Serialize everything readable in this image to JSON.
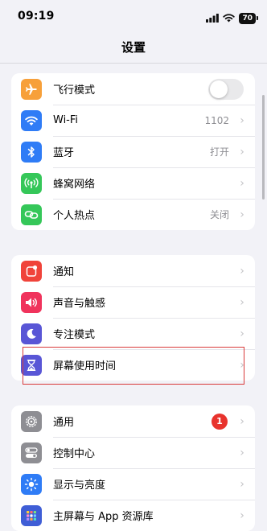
{
  "status": {
    "time": "09:19",
    "battery": "70"
  },
  "nav": {
    "title": "设置"
  },
  "colors": {
    "airplane": "#f7a03a",
    "wifi": "#2f7cf6",
    "bluetooth": "#2f7cf6",
    "cellular": "#35c759",
    "hotspot": "#35c759",
    "notifications": "#f0433a",
    "sounds": "#f0335c",
    "focus": "#5956d6",
    "screentime": "#5956d6",
    "general": "#8e8e93",
    "control": "#8e8e93",
    "display": "#2f7cf6",
    "homescreen": "#3f5ed6",
    "badge": "#e8332d"
  },
  "group1": {
    "airplane": {
      "label": "飞行模式",
      "icon": "airplane-icon",
      "toggle_on": false
    },
    "wifi": {
      "label": "Wi-Fi",
      "value": "1102",
      "icon": "wifi-icon"
    },
    "bluetooth": {
      "label": "蓝牙",
      "value": "打开",
      "icon": "bluetooth-icon"
    },
    "cellular": {
      "label": "蜂窝网络",
      "icon": "antenna-icon"
    },
    "hotspot": {
      "label": "个人热点",
      "value": "关闭",
      "icon": "link-icon"
    }
  },
  "group2": {
    "notifications": {
      "label": "通知",
      "icon": "bell-icon"
    },
    "sounds": {
      "label": "声音与触感",
      "icon": "speaker-icon"
    },
    "focus": {
      "label": "专注模式",
      "icon": "moon-icon"
    },
    "screentime": {
      "label": "屏幕使用时间",
      "icon": "hourglass-icon"
    }
  },
  "group3": {
    "general": {
      "label": "通用",
      "badge": "1",
      "icon": "gear-icon"
    },
    "control": {
      "label": "控制中心",
      "icon": "switches-icon"
    },
    "display": {
      "label": "显示与亮度",
      "icon": "sun-icon"
    },
    "homescreen": {
      "label": "主屏幕与 App 资源库",
      "icon": "app-grid-icon"
    }
  }
}
